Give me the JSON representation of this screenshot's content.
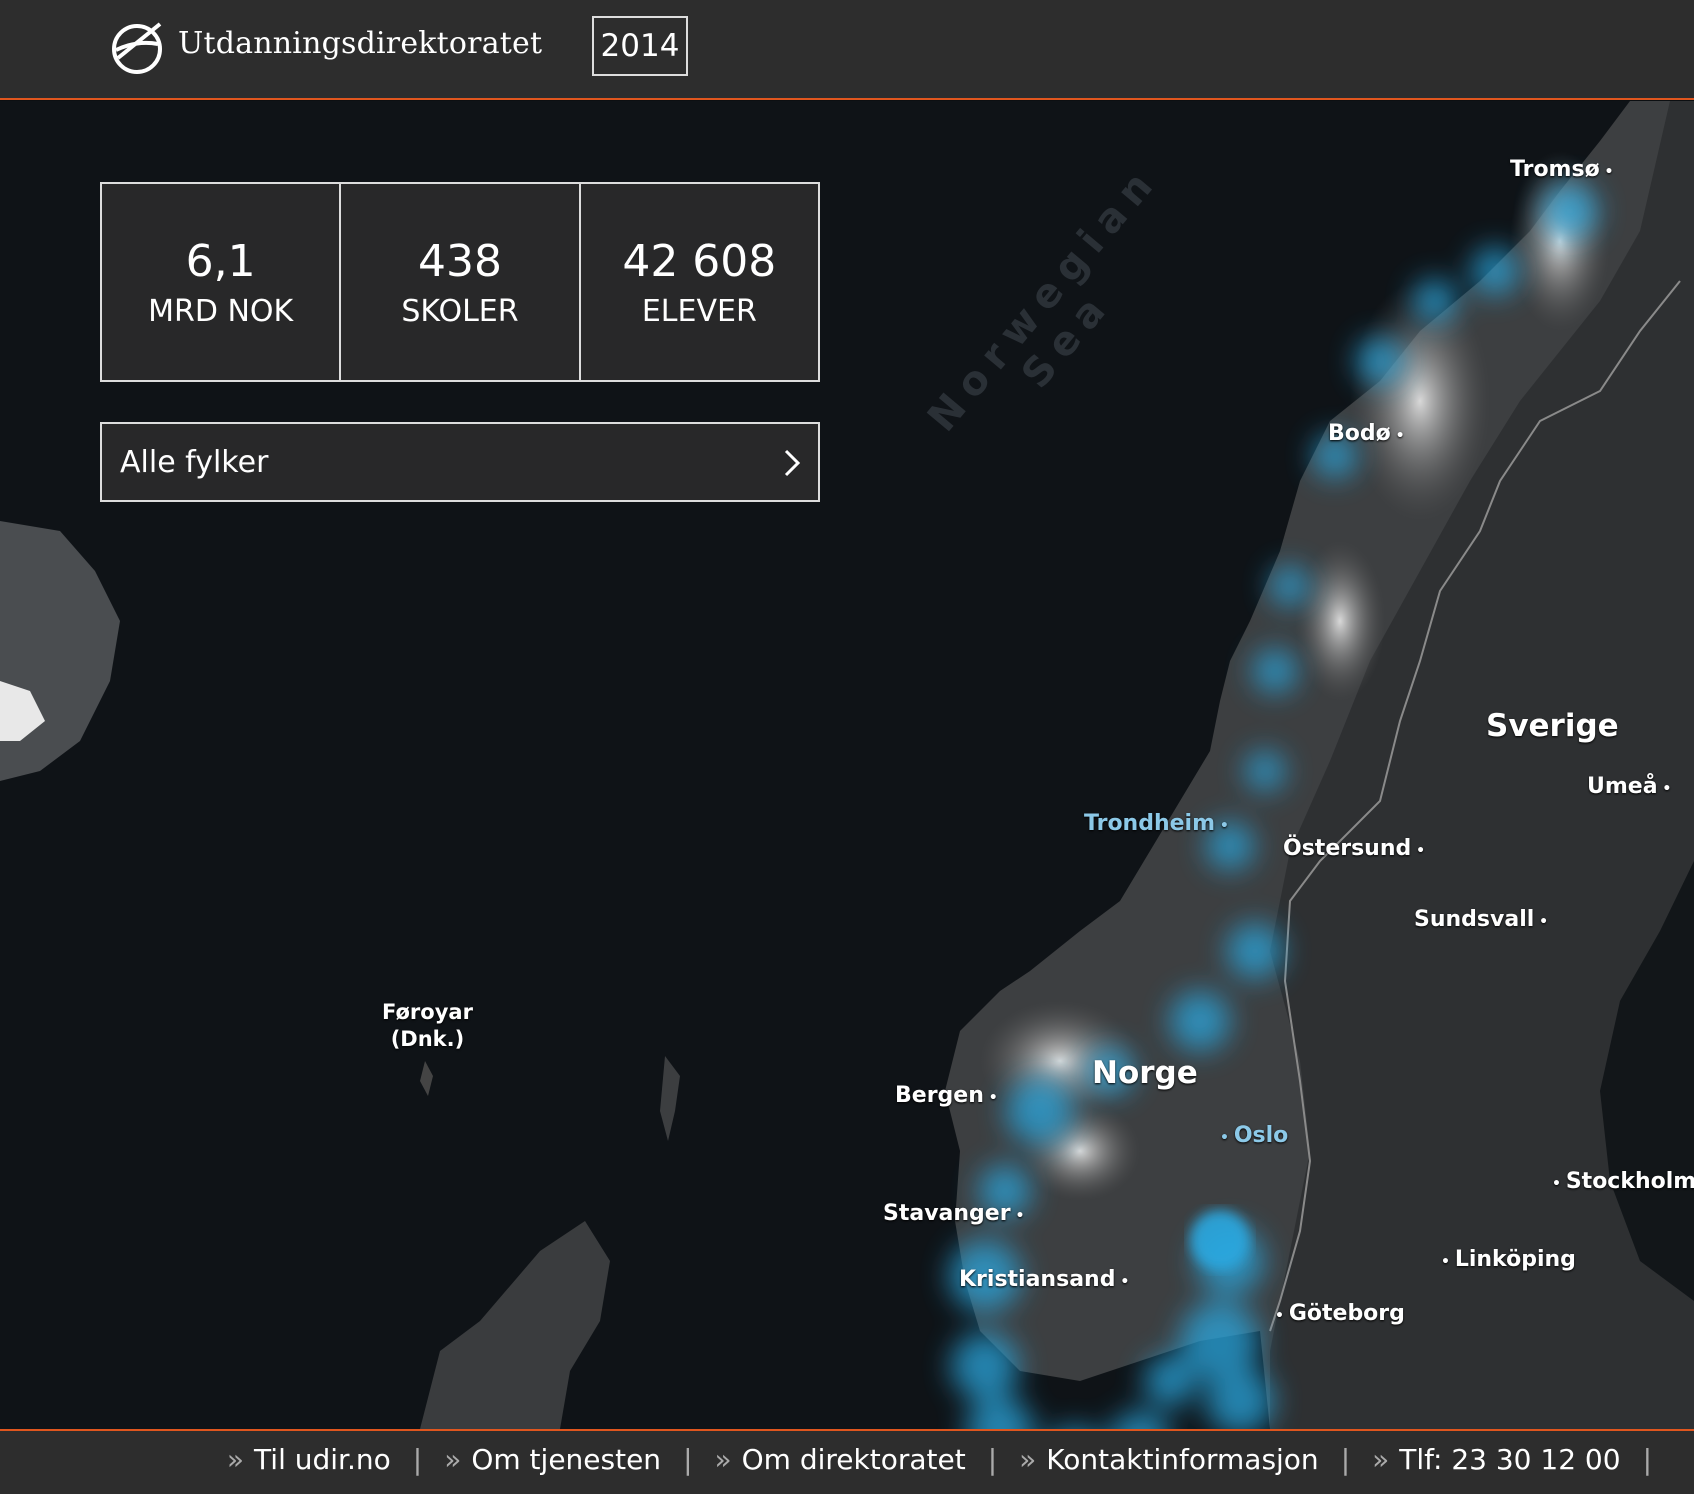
{
  "header": {
    "brand": "Utdanningsdirektoratet",
    "year": "2014"
  },
  "stats": [
    {
      "value": "6,1",
      "unit": "MRD NOK"
    },
    {
      "value": "438",
      "unit": "SKOLER"
    },
    {
      "value": "42 608",
      "unit": "ELEVER"
    }
  ],
  "region_selector": {
    "label": "Alle fylker"
  },
  "map": {
    "sea": "Norwegian Sea",
    "countries": {
      "norway": "Norge",
      "sweden": "Sverige"
    },
    "cities": {
      "tromso": "Tromsø",
      "bodo": "Bodø",
      "trondheim": "Trondheim",
      "ostersund": "Östersund",
      "sundsvall": "Sundsvall",
      "umea": "Umeå",
      "bergen": "Bergen",
      "oslo": "Oslo",
      "stavanger": "Stavanger",
      "kristiansand": "Kristiansand",
      "stockholm": "Stockholm",
      "linkoping": "Linköping",
      "goteborg": "Göteborg",
      "faroe_line1": "Føroyar",
      "faroe_line2": "(Dnk.)"
    },
    "heat_color": "#29a8e0"
  },
  "footer": {
    "links": [
      "Til udir.no",
      "Om tjenesten",
      "Om direktoratet",
      "Kontaktinformasjon",
      "Tlf: 23 30 12 00"
    ],
    "arrow": "»"
  },
  "colors": {
    "accent": "#e0561e",
    "bar": "#2d2d2d"
  }
}
